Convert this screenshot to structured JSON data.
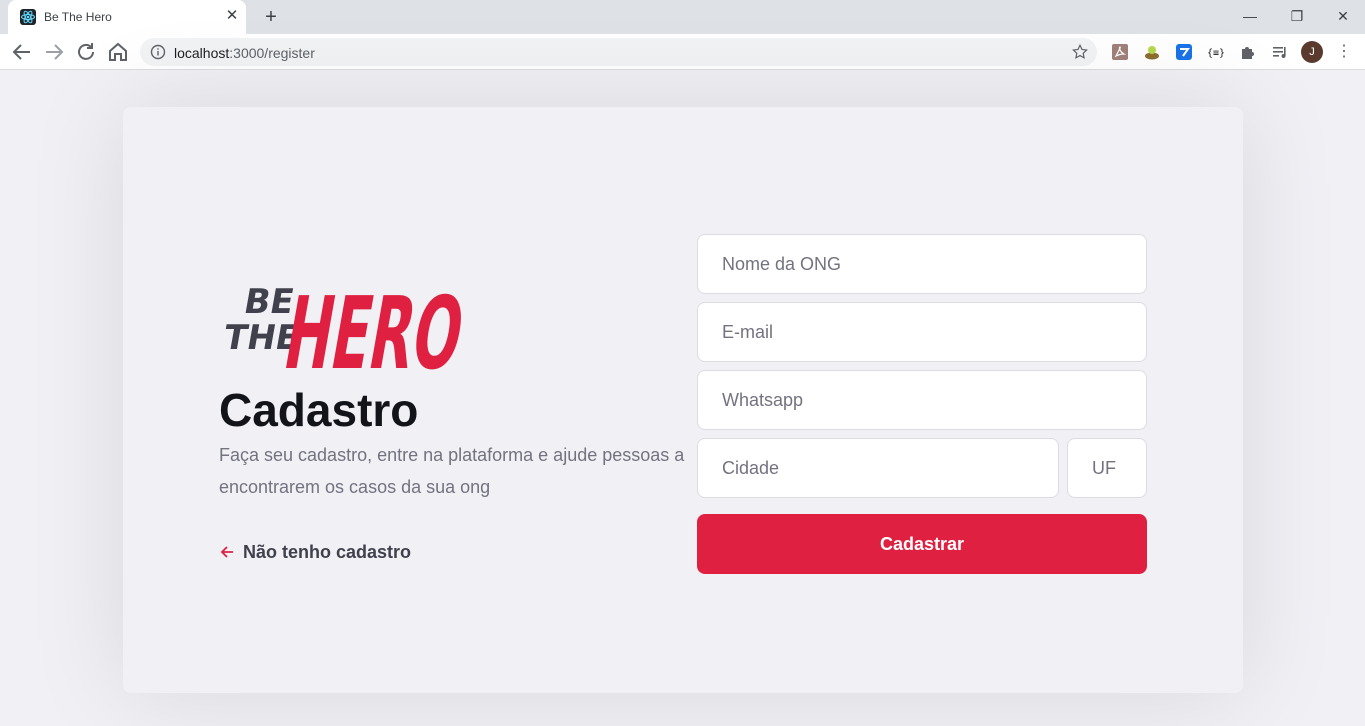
{
  "browser": {
    "tab_title": "Be The Hero",
    "url_host": "localhost",
    "url_path": ":3000/register",
    "avatar_initial": "J"
  },
  "logo": {
    "small_line_1": "BE",
    "small_line_2": "THE",
    "big_word": "HERO"
  },
  "page": {
    "title": "Cadastro",
    "description": "Faça seu cadastro, entre na plataforma e ajude pessoas a encontrarem os casos da sua ong",
    "back_link": "Não tenho cadastro"
  },
  "form": {
    "name_placeholder": "Nome da ONG",
    "email_placeholder": "E-mail",
    "whatsapp_placeholder": "Whatsapp",
    "city_placeholder": "Cidade",
    "uf_placeholder": "UF",
    "submit_label": "Cadastrar"
  },
  "colors": {
    "brand": "#e02041",
    "text_dark": "#13131a",
    "text_muted": "#737380",
    "background": "#f0f0f5"
  }
}
